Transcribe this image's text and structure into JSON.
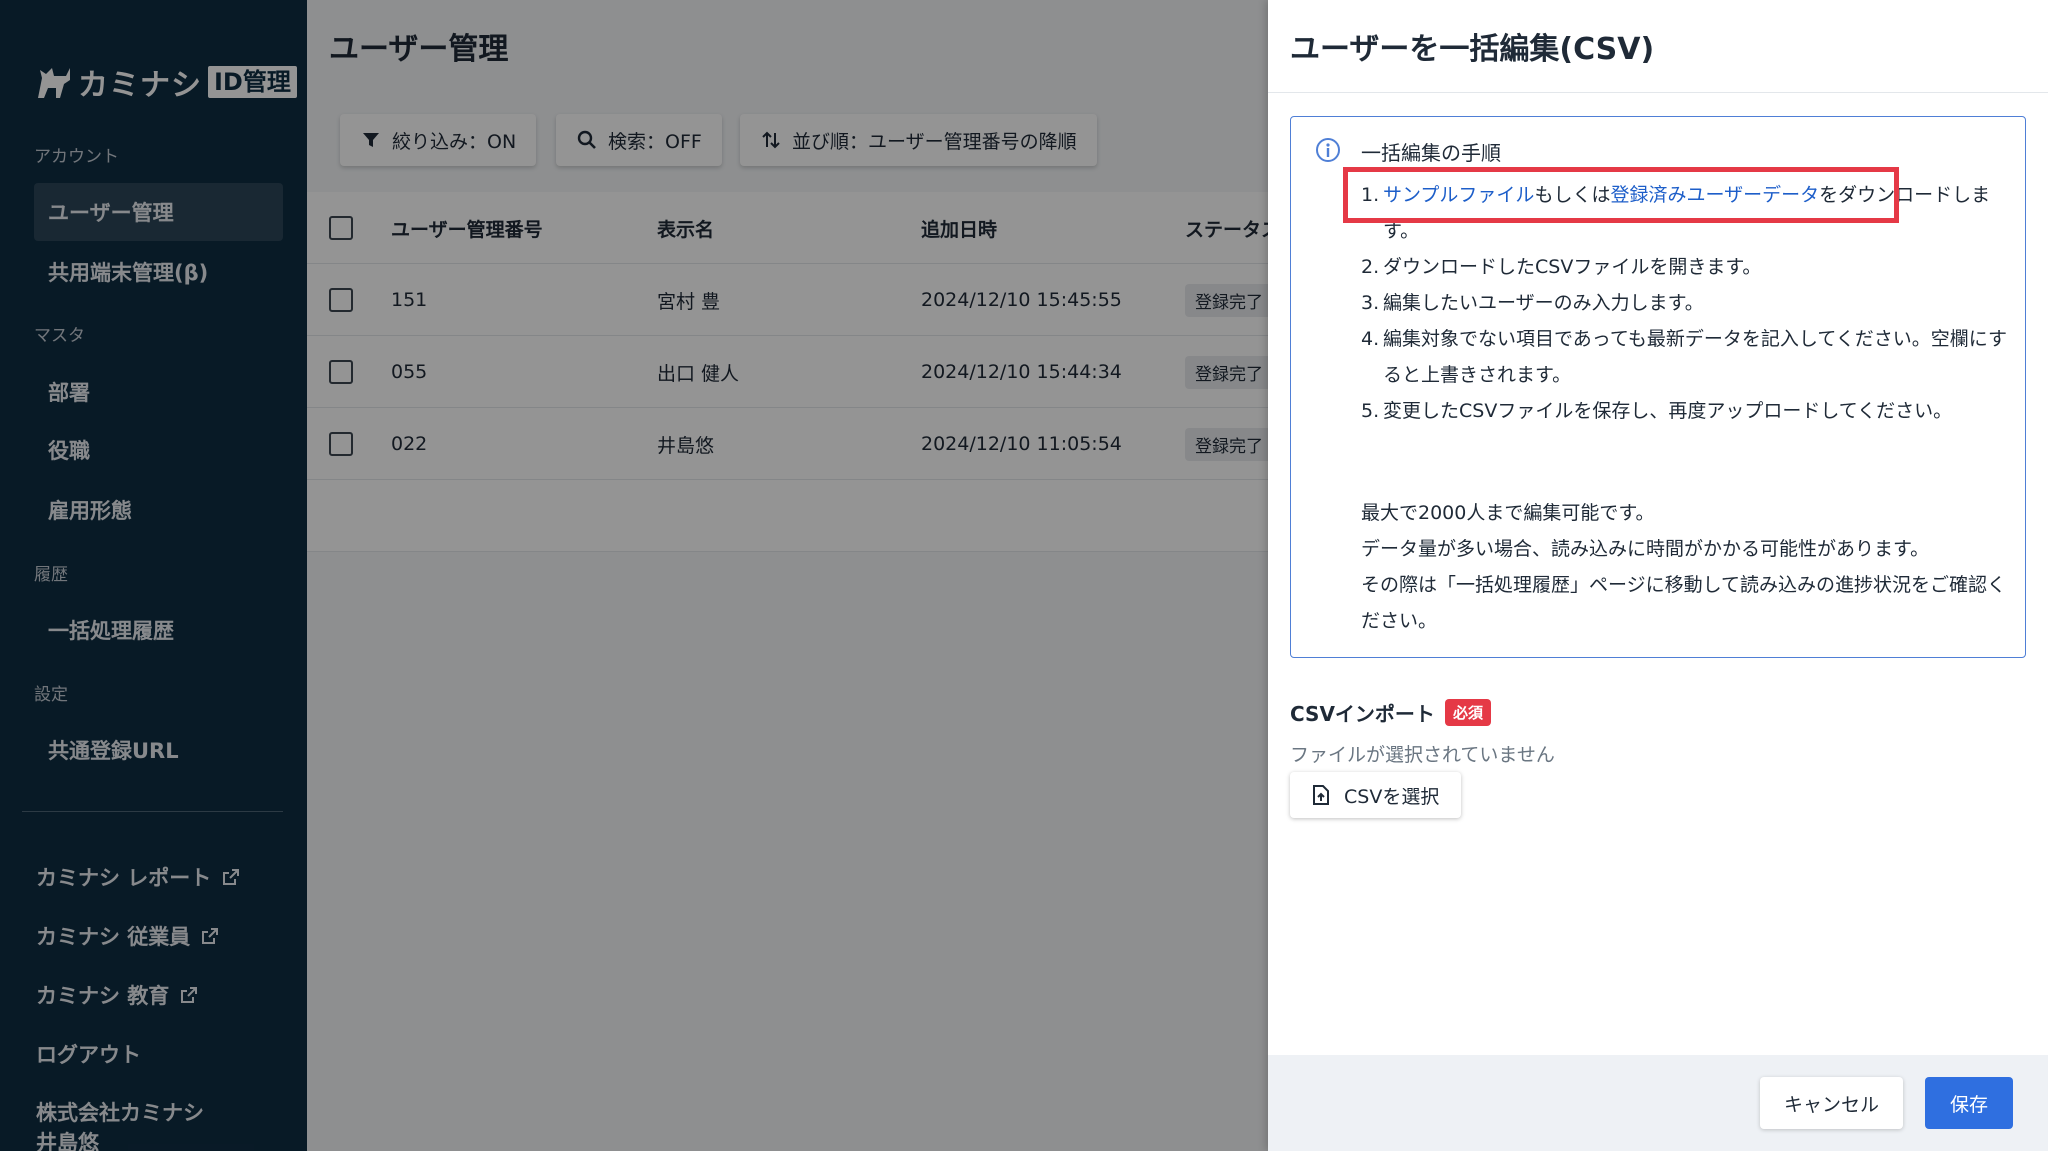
{
  "sidebar": {
    "logo_text": "カミナシ",
    "logo_badge": "ID管理",
    "sections": {
      "account": "アカウント",
      "master": "マスタ",
      "history": "履歴",
      "settings": "設定"
    },
    "items": {
      "user_management": "ユーザー管理",
      "shared_device": "共用端末管理(β)",
      "department": "部署",
      "position": "役職",
      "employment": "雇用形態",
      "batch_history": "一括処理履歴",
      "common_url": "共通登録URL"
    },
    "links": {
      "report": "カミナシ レポート",
      "employee": "カミナシ 従業員",
      "education": "カミナシ 教育",
      "logout": "ログアウト"
    },
    "company": "株式会社カミナシ",
    "user_name": "井島悠"
  },
  "main": {
    "title": "ユーザー管理",
    "toolbar": {
      "filter": "絞り込み：ON",
      "search": "検索：OFF",
      "sort": "並び順：ユーザー管理番号の降順"
    },
    "table": {
      "headers": [
        "ユーザー管理番号",
        "表示名",
        "追加日時",
        "ステータス"
      ],
      "rows": [
        {
          "id": "151",
          "name": "宮村 豊",
          "date": "2024/12/10 15:45:55",
          "status": "登録完了"
        },
        {
          "id": "055",
          "name": "出口 健人",
          "date": "2024/12/10 15:44:34",
          "status": "登録完了"
        },
        {
          "id": "022",
          "name": "井島悠",
          "date": "2024/12/10 11:05:54",
          "status": "登録完了"
        }
      ]
    }
  },
  "drawer": {
    "title": "ユーザーを一括編集(CSV)",
    "info": {
      "heading": "一括編集の手順",
      "step1": {
        "num": "1.",
        "link1": "サンプルファイル",
        "mid": "もしくは",
        "link2": "登録済みユーザーデータ",
        "tail": "をダウンロードします。"
      },
      "steps": [
        {
          "num": "2.",
          "text": "ダウンロードしたCSVファイルを開きます。"
        },
        {
          "num": "3.",
          "text": "編集したいユーザーのみ入力します。"
        },
        {
          "num": "4.",
          "text": "編集対象でない項目であっても最新データを記入してください。空欄にすると上書きされます。"
        },
        {
          "num": "5.",
          "text": "変更したCSVファイルを保存し、再度アップロードしてください。"
        }
      ],
      "notes": [
        "最大で2000人まで編集可能です。",
        "データ量が多い場合、読み込みに時間がかかる可能性があります。",
        "その際は「一括処理履歴」ページに移動して読み込みの進捗状況をご確認ください。"
      ]
    },
    "csv": {
      "label": "CSVインポート",
      "required": "必須",
      "status": "ファイルが選択されていません",
      "select": "CSVを選択"
    },
    "footer": {
      "cancel": "キャンセル",
      "save": "保存"
    }
  },
  "colors": {
    "sidebar_bg": "#0f2d43",
    "accent": "#2f6fe0",
    "link": "#1d5ec9",
    "required": "#e53946",
    "info_border": "#4f7fd6"
  },
  "icons": [
    "logo-mark-icon",
    "external-link-icon",
    "filter-icon",
    "search-icon",
    "sort-icon",
    "info-icon",
    "file-upload-icon"
  ]
}
